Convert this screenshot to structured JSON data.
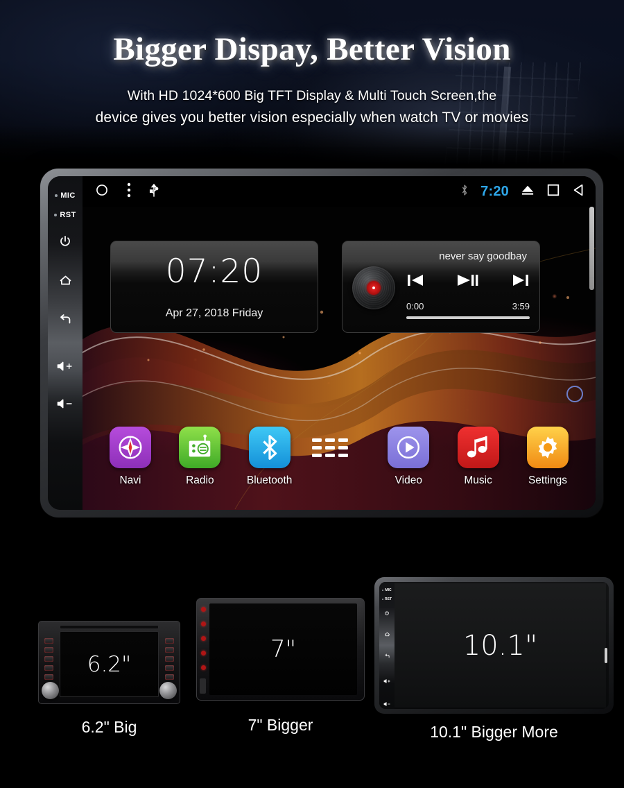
{
  "hero": {
    "title": "Bigger Dispay, Better Vision",
    "subtitle_line1": "With HD 1024*600 Big TFT Display & Multi Touch Screen,the",
    "subtitle_line2": "device gives you better vision especially when watch TV or movies"
  },
  "device": {
    "bezel_keys": [
      {
        "name": "mic",
        "label": "MIC",
        "type": "dot-label"
      },
      {
        "name": "reset",
        "label": "RST",
        "type": "dot-label"
      },
      {
        "name": "power",
        "label": "",
        "type": "icon"
      },
      {
        "name": "home",
        "label": "",
        "type": "icon"
      },
      {
        "name": "back",
        "label": "",
        "type": "icon"
      },
      {
        "name": "volume-up",
        "label": "",
        "type": "icon"
      },
      {
        "name": "volume-down",
        "label": "",
        "type": "icon"
      }
    ],
    "statusbar": {
      "left_icons": [
        "circle-icon",
        "overflow-menu-icon",
        "usb-icon"
      ],
      "bluetooth_icon": "bluetooth-icon",
      "clock": "7:20",
      "clock_color": "#2ea6e8",
      "right_icons": [
        "eject-icon",
        "recents-square-icon",
        "back-triangle-icon"
      ]
    },
    "clock_widget": {
      "time": "07:20",
      "date": "Apr 27, 2018  Friday"
    },
    "music_widget": {
      "song_title": "never say goodbay",
      "elapsed": "0:00",
      "duration": "3:59",
      "buttons": [
        "previous-track",
        "play-pause",
        "next-track"
      ]
    },
    "dock": [
      {
        "label": "Navi",
        "icon": "compass-icon",
        "color": "#a63cd0"
      },
      {
        "label": "Radio",
        "icon": "radio-icon",
        "color": "#5fc433"
      },
      {
        "label": "Bluetooth",
        "icon": "bluetooth-icon",
        "color": "#23a8e8"
      },
      {
        "label": "",
        "icon": "app-grid-icon",
        "color": "#000000"
      },
      {
        "label": "Video",
        "icon": "play-circle-icon",
        "color": "#8a7fe0"
      },
      {
        "label": "Music",
        "icon": "music-note-icon",
        "color": "#d82222"
      },
      {
        "label": "Settings",
        "icon": "gear-icon",
        "color": "#f59a16"
      }
    ]
  },
  "comparison": [
    {
      "screen_text": "6.2\"",
      "caption": "6.2\" Big"
    },
    {
      "screen_text": "7\"",
      "caption": "7\" Bigger"
    },
    {
      "screen_text": "10.1\"",
      "caption": "10.1\" Bigger More"
    }
  ]
}
